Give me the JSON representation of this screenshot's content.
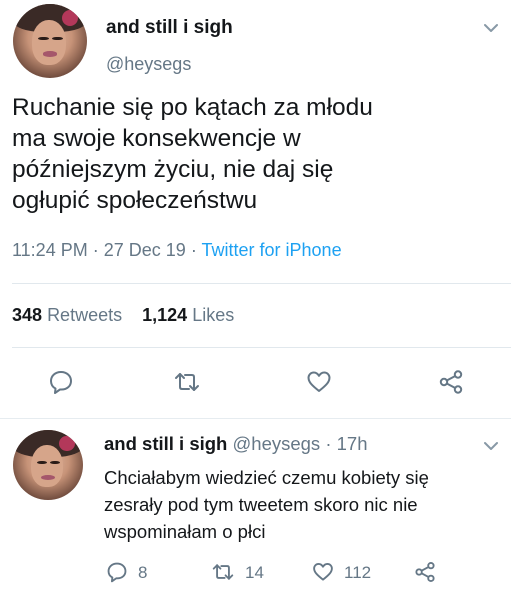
{
  "tweet": {
    "author_name": "and still i sigh",
    "author_handle": "@heysegs",
    "text_lines": [
      "Ruchanie się po kątach za młodu",
      "ma swoje konsekwencje w",
      "późniejszym życiu, nie daj się",
      "ogłupić społeczeństwu"
    ],
    "time": "11:24 PM",
    "date": "27 Dec 19",
    "source": "Twitter for iPhone",
    "separator": "·",
    "retweets_count": "348",
    "retweets_label": "Retweets",
    "likes_count": "1,124",
    "likes_label": "Likes"
  },
  "reply": {
    "author_name": "and still i sigh",
    "author_handle": "@heysegs",
    "separator": "·",
    "age": "17h",
    "text_lines": [
      "Chciałabym wiedzieć czemu kobiety się",
      "zesrały pod tym tweetem skoro nic nie",
      "wspominałam o płci"
    ],
    "reply_count": "8",
    "retweet_count": "14",
    "like_count": "112"
  },
  "colors": {
    "secondary_text": "#657786",
    "link": "#1da1f2",
    "divider": "#e1e8ed"
  },
  "icons": {
    "reply": "speech-bubble-icon",
    "retweet": "retweet-arrows-icon",
    "like": "heart-icon",
    "share": "share-nodes-icon",
    "menu": "chevron-down-icon"
  }
}
